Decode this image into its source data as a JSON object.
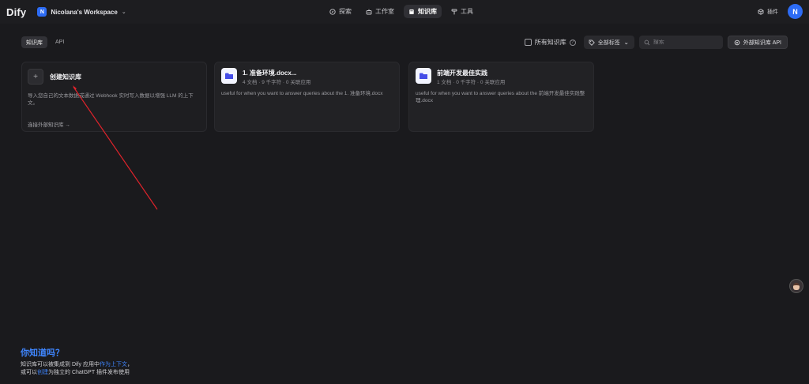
{
  "app": {
    "logo": "Dify"
  },
  "workspace": {
    "badge": "N",
    "name": "Nicolana's Workspace"
  },
  "nav": {
    "items": [
      {
        "label": "探索",
        "icon": "compass-icon",
        "active": false
      },
      {
        "label": "工作室",
        "icon": "robot-icon",
        "active": false
      },
      {
        "label": "知识库",
        "icon": "book-icon",
        "active": true
      },
      {
        "label": "工具",
        "icon": "hammer-icon",
        "active": false
      }
    ]
  },
  "header_right": {
    "plugins_label": "插件",
    "avatar_initial": "N"
  },
  "tabs": [
    {
      "label": "知识库",
      "active": true
    },
    {
      "label": "API",
      "active": false
    }
  ],
  "filters": {
    "all_kb_label": "所有知识库",
    "tags_label": "全部标签",
    "search_placeholder": "搜索",
    "external_api_label": "外部知识库 API"
  },
  "create_card": {
    "plus": "+",
    "title": "创建知识库",
    "description": "导入您自己的文本数据或通过 Webhook 实时写入数据以增强 LLM 的上下文。",
    "external_link": "连接外部知识库 →"
  },
  "datasets": [
    {
      "title": "1. 准备环境.docx...",
      "meta": "4 文档 · 9 千字符 · 0 关联应用",
      "description": "useful for when you want to answer queries about the 1. 准备环境.docx"
    },
    {
      "title": "前端开发最佳实践",
      "meta": "1 文档 · 0 千字符 · 0 关联应用",
      "description": "useful for when you want to answer queries about the 前端开发最佳实践整理.docx"
    }
  ],
  "tip": {
    "title": "你知道吗？",
    "line1_pre": "知识库可以被集成到 Dify 应用中",
    "line1_link": "作为上下文",
    "line1_post": "，",
    "line2_pre": "或可以",
    "line2_link": "创建",
    "line2_post": "为独立的 ChatGPT 插件发布使用"
  },
  "colors": {
    "accent": "#2d6cf5",
    "link": "#3f86ff",
    "annotation_arrow": "#e0232b",
    "background": "#1a1a1d"
  }
}
